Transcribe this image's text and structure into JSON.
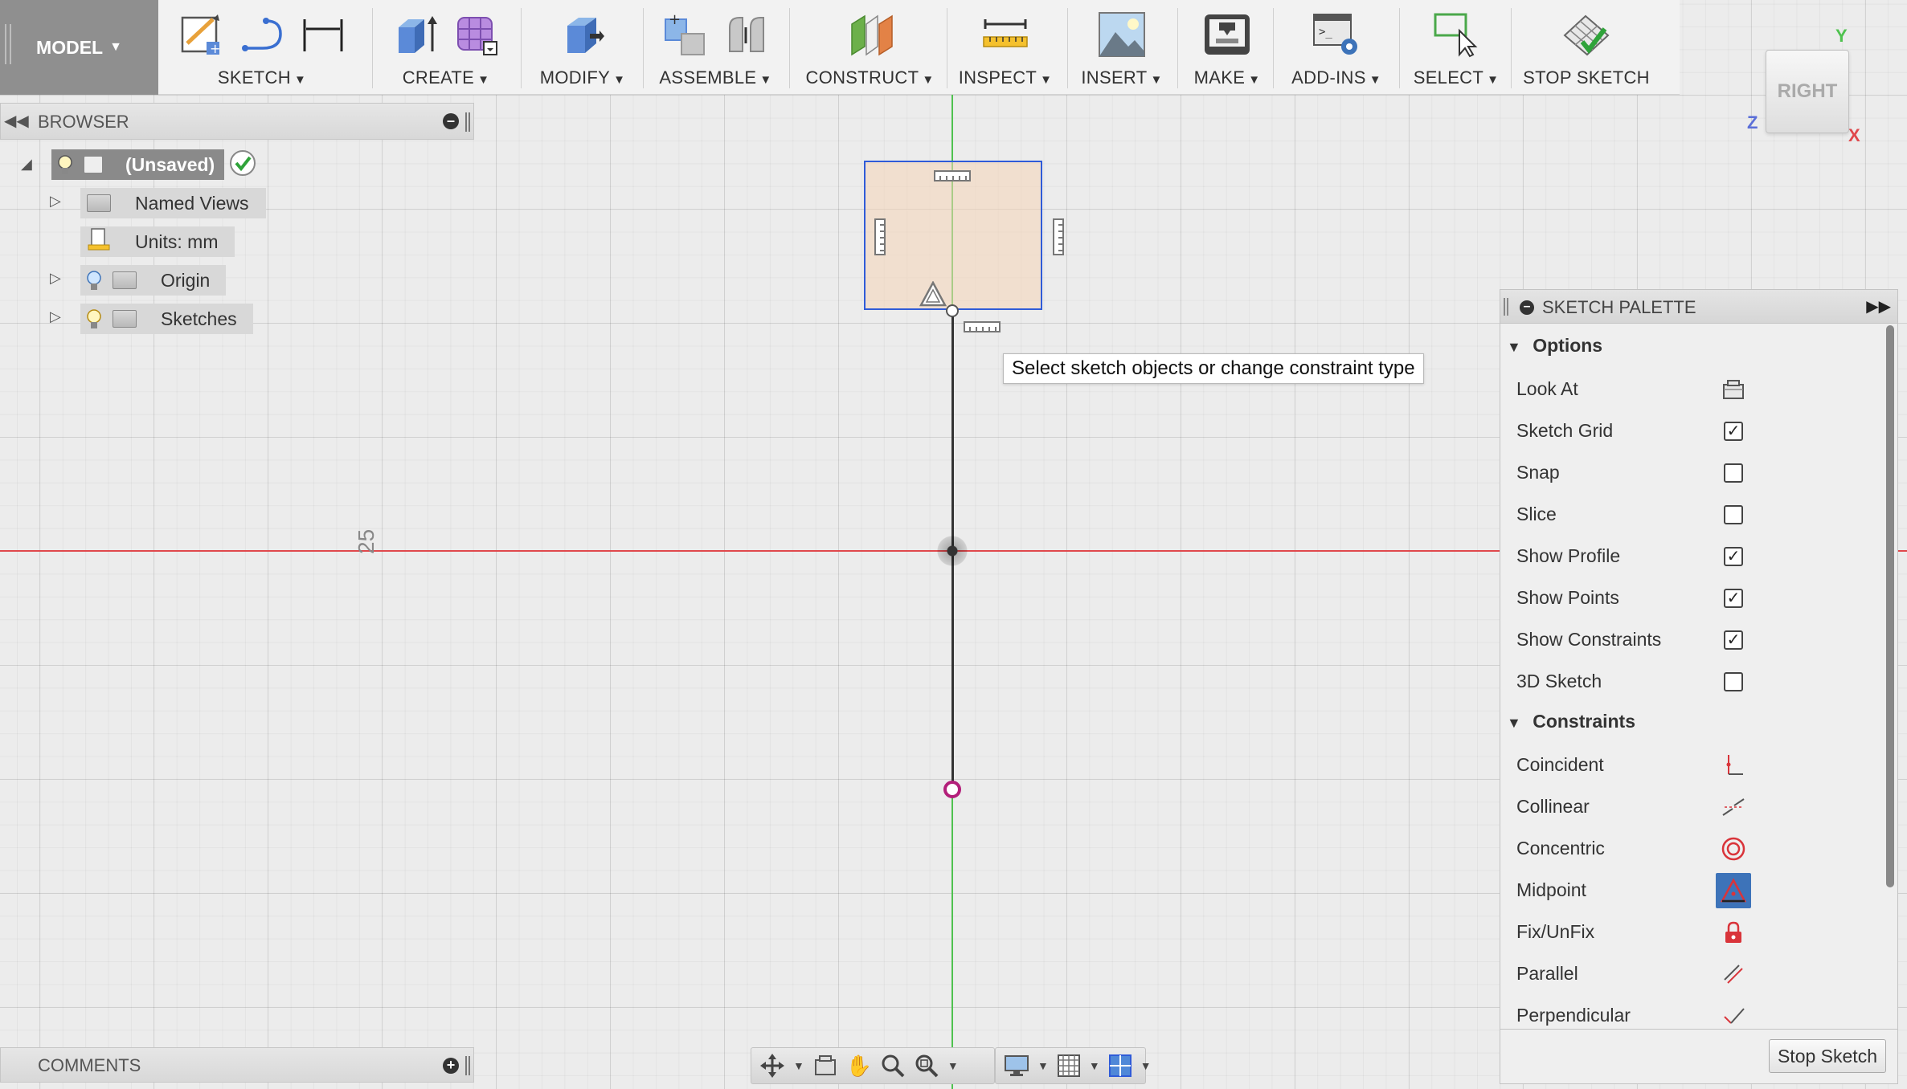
{
  "toolbar": {
    "model_label": "MODEL",
    "groups": [
      {
        "label": "SKETCH"
      },
      {
        "label": "CREATE"
      },
      {
        "label": "MODIFY"
      },
      {
        "label": "ASSEMBLE"
      },
      {
        "label": "CONSTRUCT"
      },
      {
        "label": "INSPECT"
      },
      {
        "label": "INSERT"
      },
      {
        "label": "MAKE"
      },
      {
        "label": "ADD-INS"
      },
      {
        "label": "SELECT"
      },
      {
        "label": "STOP SKETCH"
      }
    ]
  },
  "viewcube": {
    "face": "RIGHT",
    "axis_y": "Y",
    "axis_z": "Z",
    "axis_x": "X",
    "colors": {
      "y": "#4fc24f",
      "z": "#5b6fd8",
      "x": "#e0484c"
    }
  },
  "browser": {
    "title": "BROWSER",
    "root": "(Unsaved)",
    "items": [
      {
        "label": "Named Views"
      },
      {
        "label": "Units: mm"
      },
      {
        "label": "Origin"
      },
      {
        "label": "Sketches"
      }
    ]
  },
  "canvas": {
    "dimension_label": "25",
    "tooltip": "Select sketch objects or change constraint type"
  },
  "comments": {
    "title": "COMMENTS"
  },
  "palette": {
    "title": "SKETCH PALETTE",
    "options_title": "Options",
    "options": [
      {
        "label": "Look At",
        "control": "look-at-icon"
      },
      {
        "label": "Sketch Grid",
        "checked": true
      },
      {
        "label": "Snap",
        "checked": false
      },
      {
        "label": "Slice",
        "checked": false
      },
      {
        "label": "Show Profile",
        "checked": true
      },
      {
        "label": "Show Points",
        "checked": true
      },
      {
        "label": "Show Constraints",
        "checked": true
      },
      {
        "label": "3D Sketch",
        "checked": false
      }
    ],
    "constraints_title": "Constraints",
    "constraints": [
      {
        "label": "Coincident",
        "icon": "coincident-icon"
      },
      {
        "label": "Collinear",
        "icon": "collinear-icon"
      },
      {
        "label": "Concentric",
        "icon": "concentric-icon"
      },
      {
        "label": "Midpoint",
        "icon": "midpoint-icon",
        "active": true
      },
      {
        "label": "Fix/UnFix",
        "icon": "lock-icon"
      },
      {
        "label": "Parallel",
        "icon": "parallel-icon"
      },
      {
        "label": "Perpendicular",
        "icon": "perpendicular-icon"
      }
    ],
    "stop_button": "Stop Sketch"
  },
  "colors": {
    "accent_blue": "#2f5bd8",
    "axis_green": "#4fc24f",
    "axis_red": "#e0484c",
    "midpoint_active": "#3d73b9",
    "constraint_red": "#d9343a"
  }
}
